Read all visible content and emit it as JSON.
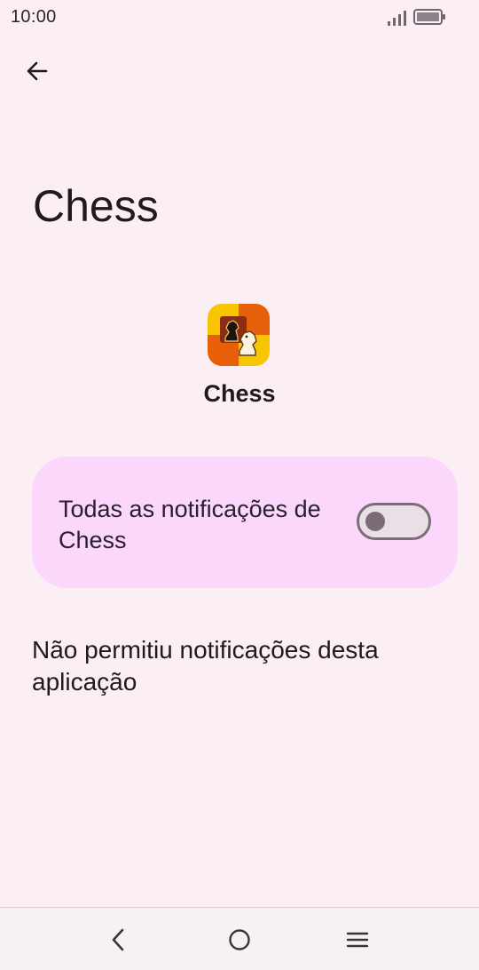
{
  "status_bar": {
    "time": "10:00",
    "icons": [
      "signal-icon",
      "battery-icon"
    ]
  },
  "header": {
    "back_icon": "arrow-back-icon"
  },
  "page": {
    "title": "Chess",
    "app_icon": "chess-app-icon",
    "app_name": "Chess"
  },
  "notification_card": {
    "label": "Todas as notificações de Chess",
    "toggle_state": "off",
    "background_color": "#fcd7fc"
  },
  "info": {
    "text": "Não permitiu notificações desta aplicação"
  },
  "nav_bar": {
    "icons": [
      "nav-back-icon",
      "nav-home-icon",
      "nav-menu-icon"
    ]
  },
  "colors": {
    "background": "#fbeff5",
    "toggle_track": "#eadfe6",
    "toggle_outline": "#7a6d78"
  }
}
